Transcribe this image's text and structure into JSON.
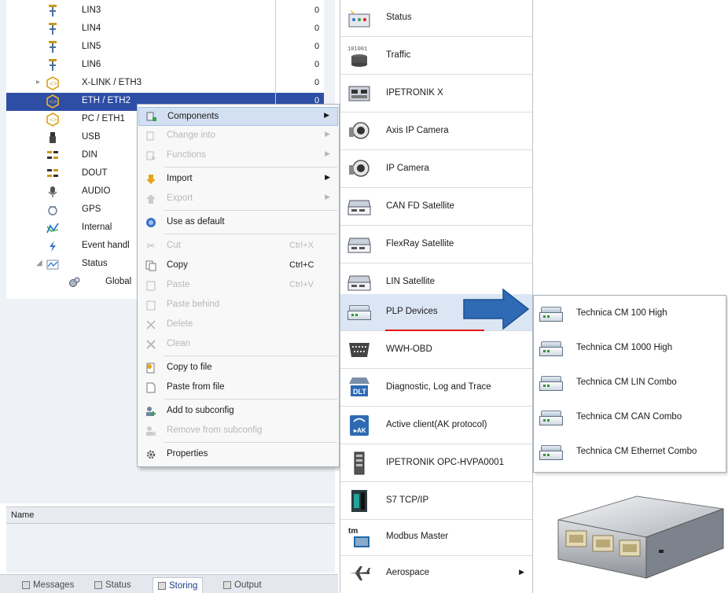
{
  "tree": {
    "rows": [
      {
        "label": "LIN3",
        "value": "0",
        "icon": "lin-icon"
      },
      {
        "label": "LIN4",
        "value": "0",
        "icon": "lin-icon"
      },
      {
        "label": "LIN5",
        "value": "0",
        "icon": "lin-icon"
      },
      {
        "label": "LIN6",
        "value": "0",
        "icon": "lin-icon"
      },
      {
        "label": "X-LINK / ETH3",
        "value": "0",
        "icon": "ethernet-icon"
      },
      {
        "label": "ETH / ETH2",
        "value": "0",
        "icon": "ethernet-icon"
      },
      {
        "label": "PC / ETH1",
        "value": "",
        "icon": "ethernet-icon"
      },
      {
        "label": "USB",
        "value": "",
        "icon": "usb-icon"
      },
      {
        "label": "DIN",
        "value": "",
        "icon": "digital-in-icon"
      },
      {
        "label": "DOUT",
        "value": "",
        "icon": "digital-out-icon"
      },
      {
        "label": "AUDIO",
        "value": "",
        "icon": "microphone-icon"
      },
      {
        "label": "GPS",
        "value": "",
        "icon": "gps-icon"
      },
      {
        "label": "Internal",
        "value": "",
        "icon": "internal-icon"
      },
      {
        "label": "Event handl",
        "value": "",
        "icon": "event-icon"
      },
      {
        "label": "Status",
        "value": "",
        "icon": "status-icon"
      },
      {
        "label": "Global",
        "value": "",
        "icon": "global-icon"
      }
    ],
    "selected_index": 5
  },
  "context_menu": {
    "items": [
      {
        "label": "Components",
        "shortcut": "",
        "icon": "components-icon",
        "enabled": true,
        "submenu": true
      },
      {
        "label": "Change into",
        "shortcut": "",
        "icon": "change-icon",
        "enabled": false,
        "submenu": true
      },
      {
        "label": "Functions",
        "shortcut": "",
        "icon": "functions-icon",
        "enabled": false,
        "submenu": true
      },
      {
        "label": "Import",
        "shortcut": "",
        "icon": "import-icon",
        "enabled": true,
        "submenu": true
      },
      {
        "label": "Export",
        "shortcut": "",
        "icon": "export-icon",
        "enabled": false,
        "submenu": true
      },
      {
        "label": "Use as default",
        "shortcut": "",
        "icon": "default-icon",
        "enabled": true,
        "submenu": false
      },
      {
        "label": "Cut",
        "shortcut": "Ctrl+X",
        "icon": "cut-icon",
        "enabled": false,
        "submenu": false
      },
      {
        "label": "Copy",
        "shortcut": "Ctrl+C",
        "icon": "copy-icon",
        "enabled": true,
        "submenu": false
      },
      {
        "label": "Paste",
        "shortcut": "Ctrl+V",
        "icon": "paste-icon",
        "enabled": false,
        "submenu": false
      },
      {
        "label": "Paste behind",
        "shortcut": "",
        "icon": "paste-behind-icon",
        "enabled": false,
        "submenu": false
      },
      {
        "label": "Delete",
        "shortcut": "",
        "icon": "delete-icon",
        "enabled": false,
        "submenu": false
      },
      {
        "label": "Clean",
        "shortcut": "",
        "icon": "clean-icon",
        "enabled": false,
        "submenu": false
      },
      {
        "label": "Copy to file",
        "shortcut": "",
        "icon": "copy-to-file-icon",
        "enabled": true,
        "submenu": false
      },
      {
        "label": "Paste from file",
        "shortcut": "",
        "icon": "paste-from-file-icon",
        "enabled": true,
        "submenu": false
      },
      {
        "label": "Add to subconfig",
        "shortcut": "",
        "icon": "add-subconfig-icon",
        "enabled": true,
        "submenu": false
      },
      {
        "label": "Remove from subconfig",
        "shortcut": "",
        "icon": "remove-subconfig-icon",
        "enabled": false,
        "submenu": false
      },
      {
        "label": "Properties",
        "shortcut": "",
        "icon": "properties-icon",
        "enabled": true,
        "submenu": false
      }
    ]
  },
  "components": {
    "items": [
      {
        "label": "Status",
        "icon": "status-icon"
      },
      {
        "label": "Traffic",
        "icon": "traffic-icon"
      },
      {
        "label": "IPETRONIK X",
        "icon": "ipetronik-x-icon"
      },
      {
        "label": "Axis IP Camera",
        "icon": "camera-icon"
      },
      {
        "label": "IP Camera",
        "icon": "camera-icon"
      },
      {
        "label": "CAN FD Satellite",
        "icon": "satellite-device-icon"
      },
      {
        "label": "FlexRay Satellite",
        "icon": "satellite-device-icon"
      },
      {
        "label": "LIN Satellite",
        "icon": "satellite-device-icon"
      },
      {
        "label": "PLP Devices",
        "icon": "plp-device-icon"
      },
      {
        "label": "WWH-OBD",
        "icon": "obd-connector-icon"
      },
      {
        "label": "Diagnostic, Log and Trace",
        "icon": "dlt-icon"
      },
      {
        "label": "Active client(AK protocol)",
        "icon": "ak-protocol-icon"
      },
      {
        "label": "IPETRONIK OPC-HVPA0001",
        "icon": "opc-device-icon"
      },
      {
        "label": "S7 TCP/IP",
        "icon": "s7-plc-icon"
      },
      {
        "label": "Modbus Master",
        "icon": "modbus-icon"
      },
      {
        "label": "Aerospace",
        "icon": "airplane-icon"
      }
    ],
    "highlighted_index": 8,
    "traffic_badge": "101001"
  },
  "plp_submenu": {
    "items": [
      {
        "label": "Technica CM 100 High"
      },
      {
        "label": "Technica CM 1000 High"
      },
      {
        "label": "Technica CM LIN Combo"
      },
      {
        "label": "Technica CM CAN Combo"
      },
      {
        "label": "Technica CM Ethernet Combo"
      }
    ]
  },
  "bottom": {
    "name_header": "Name",
    "tabs": [
      {
        "label": "Messages"
      },
      {
        "label": "Status"
      },
      {
        "label": "Storing"
      },
      {
        "label": "Output"
      }
    ],
    "active_tab": "Storing"
  },
  "colors": {
    "selection": "#2e4ea6",
    "menu_highlight": "#d3e0f2",
    "arrow": "#2f6ab4",
    "underline": "#e8141b"
  }
}
